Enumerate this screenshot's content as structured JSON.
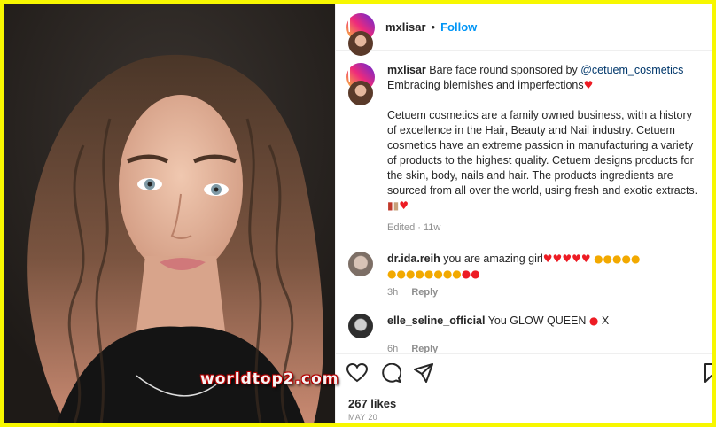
{
  "post": {
    "username": "mxlisar",
    "dot": "•",
    "follow_label": "Follow",
    "caption": {
      "username": "mxlisar",
      "line1": "Bare face round sponsored by",
      "mention": "@cetuem_cosmetics",
      "line2": "Embracing blemishes and imperfections",
      "paragraph": "Cetuem cosmetics are a family owned business, with a history of excellence in the Hair, Beauty and Nail industry. Cetuem cosmetics have an extreme passion in manufacturing a variety of products to the highest quality. Cetuem designs products for the skin, body, nails and hair. The products ingredients are sourced from all over the world, using fresh and exotic extracts.",
      "meta": "Edited · 11w"
    },
    "comments": [
      {
        "username": "dr.ida.reih",
        "text": "you are amazing girl",
        "emoji_line1": "♥♥♥♥♥",
        "emoji_line2": "",
        "time": "3h",
        "reply_label": "Reply"
      },
      {
        "username": "elle_seline_official",
        "text": "You GLOW QUEEN",
        "suffix": "X",
        "time": "6h",
        "reply_label": "Reply"
      }
    ],
    "likes": "267 likes",
    "date": "MAY 20"
  },
  "watermark": "worldtop2.com",
  "icons": [
    "heart-icon",
    "comment-icon",
    "share-icon",
    "bookmark-icon",
    "more-icon"
  ],
  "colors": {
    "follow": "#0095f6",
    "frame": "#f7f700",
    "heart": "#ed1c24"
  }
}
